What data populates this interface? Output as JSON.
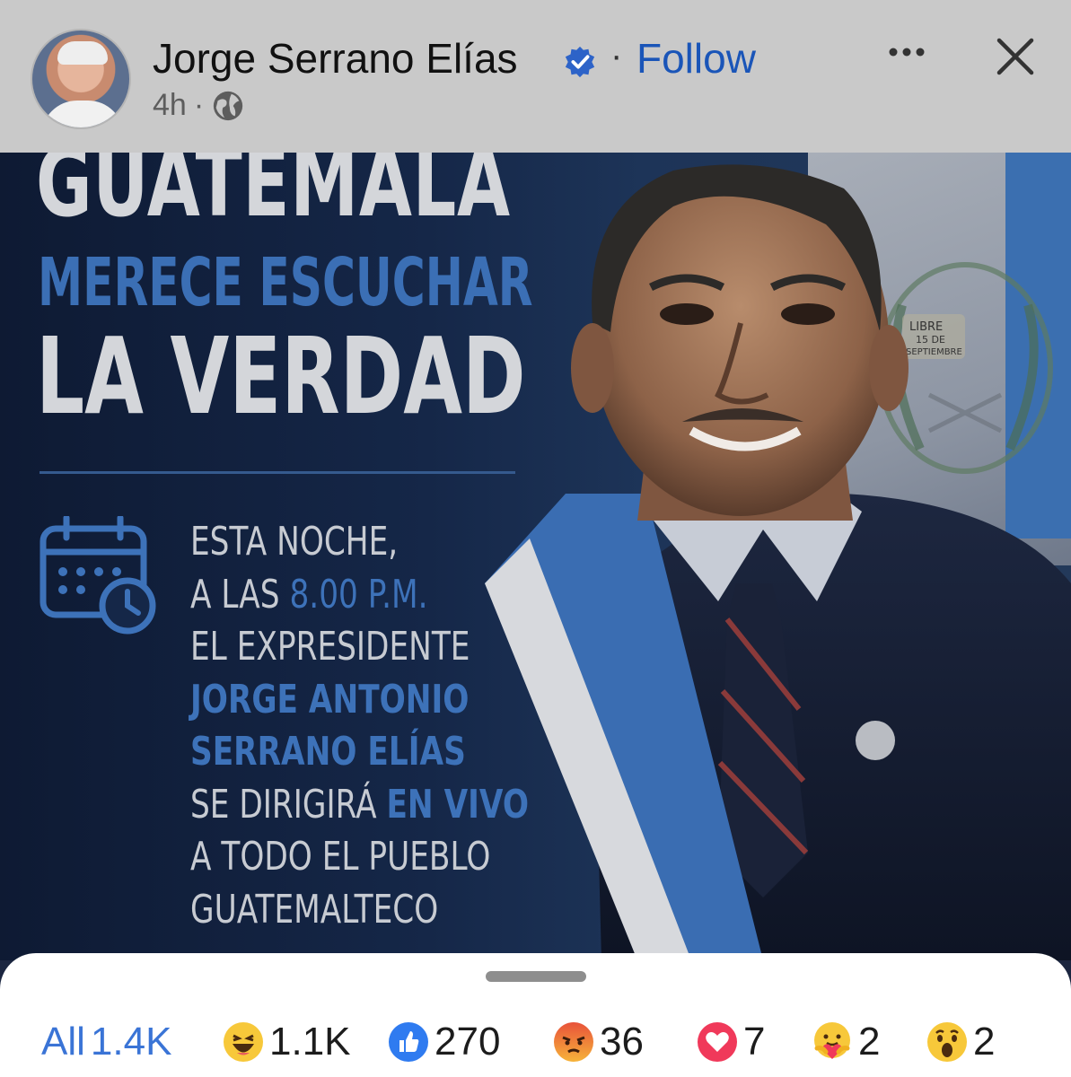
{
  "header": {
    "author_name": "Jorge Serrano Elías",
    "separator": "·",
    "follow_label": "Follow",
    "time_ago": "4h",
    "meta_separator": "·"
  },
  "poster": {
    "title_line1": "GUATEMALA",
    "title_line2": "MERECE ESCUCHAR",
    "title_line3": "LA VERDAD",
    "info": {
      "line1": "ESTA NOCHE,",
      "line2_prefix": "A LAS ",
      "line2_time": "8.00 P.M.",
      "line3": "EL EXPRESIDENTE",
      "line4": "JORGE ANTONIO",
      "line5": "SERRANO ELÍAS",
      "line6_prefix": "SE DIRIGIRÁ ",
      "line6_highlight": "EN VIVO",
      "line7": "A TODO EL PUEBLO",
      "line8": "GUATEMALTECO"
    },
    "emblem_text": [
      "LIBRE",
      "15 DE",
      "SEPTIEMBRE"
    ]
  },
  "reactions": {
    "all_label": "All",
    "all_count": "1.4K",
    "items": [
      {
        "icon": "haha-icon",
        "count": "1.1K"
      },
      {
        "icon": "like-icon",
        "count": "270"
      },
      {
        "icon": "angry-icon",
        "count": "36"
      },
      {
        "icon": "love-icon",
        "count": "7"
      },
      {
        "icon": "care-icon",
        "count": "2"
      },
      {
        "icon": "wow-icon",
        "count": "2"
      }
    ]
  },
  "colors": {
    "header_bg": "#c9c9c9",
    "follow": "#1a55b8",
    "accent_blue": "#3d72b9",
    "poster_text": "#c7cbd2",
    "all_tab": "#3a74d6"
  }
}
